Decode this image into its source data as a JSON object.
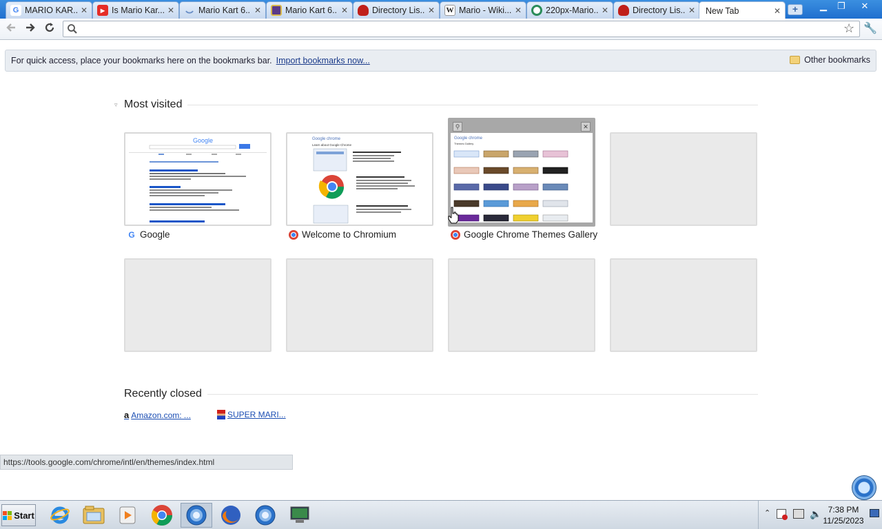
{
  "tabs": [
    {
      "title": "MARIO KAR...",
      "icon": "google-icon",
      "color": "#4285f4"
    },
    {
      "title": "Is Mario Kar...",
      "icon": "youtube-icon",
      "color": "#e52d27"
    },
    {
      "title": "Mario Kart 6...",
      "icon": "loading-icon",
      "color": "#6a8fc7"
    },
    {
      "title": "Mario Kart 6...",
      "icon": "newspaper-icon",
      "color": "#5a3a8a"
    },
    {
      "title": "Directory Lis...",
      "icon": "red-blob-icon",
      "color": "#c0201a"
    },
    {
      "title": "Mario - Wiki...",
      "icon": "wikipedia-icon",
      "color": "#333333"
    },
    {
      "title": "220px-Mario...",
      "icon": "wikimedia-icon",
      "color": "#2a8c5a"
    },
    {
      "title": "Directory Lis...",
      "icon": "red-blob-icon",
      "color": "#c0201a"
    },
    {
      "title": "New Tab",
      "icon": "",
      "color": "#ffffff"
    }
  ],
  "omnibox": {
    "value": ""
  },
  "bookmark_bar": {
    "message": "For quick access, place your bookmarks here on the bookmarks bar.",
    "import_link": "Import bookmarks now...",
    "other_bookmarks": "Other bookmarks"
  },
  "most_visited": {
    "title": "Most visited",
    "tiles": [
      {
        "label": "Google",
        "icon": "google-icon",
        "preview": "google-search-results"
      },
      {
        "label": "Welcome to Chromium",
        "icon": "chromium-icon",
        "preview": "google-chrome-welcome"
      },
      {
        "label": "Google Chrome Themes Gallery",
        "icon": "chromium-icon",
        "preview": "themes-gallery"
      },
      {
        "label": "",
        "icon": "",
        "preview": "empty"
      },
      {
        "label": "",
        "icon": "",
        "preview": "empty"
      },
      {
        "label": "",
        "icon": "",
        "preview": "empty"
      },
      {
        "label": "",
        "icon": "",
        "preview": "empty"
      },
      {
        "label": "",
        "icon": "",
        "preview": "empty"
      }
    ],
    "preview_text": {
      "google_logo": "Google",
      "chrome_logo": "Google chrome",
      "chrome_heading": "Learn about Google Chrome",
      "gallery_logo": "Google chrome",
      "gallery_heading": "Themes Gallery"
    }
  },
  "recently_closed": {
    "title": "Recently closed",
    "items": [
      {
        "label": "Amazon.com: ...",
        "icon": "amazon-icon"
      },
      {
        "label": "SUPER MARI...",
        "icon": "mario-icon"
      }
    ]
  },
  "status_bar": {
    "url": "https://tools.google.com/chrome/intl/en/themes/index.html"
  },
  "taskbar": {
    "start_label": "Start",
    "clock_time": "7:38 PM",
    "clock_date": "11/25/2023",
    "apps": [
      "internet-explorer-icon",
      "file-explorer-icon",
      "media-player-icon",
      "chrome-icon",
      "chromium-icon",
      "firefox-icon",
      "chromium-icon",
      "remote-desktop-icon"
    ]
  }
}
